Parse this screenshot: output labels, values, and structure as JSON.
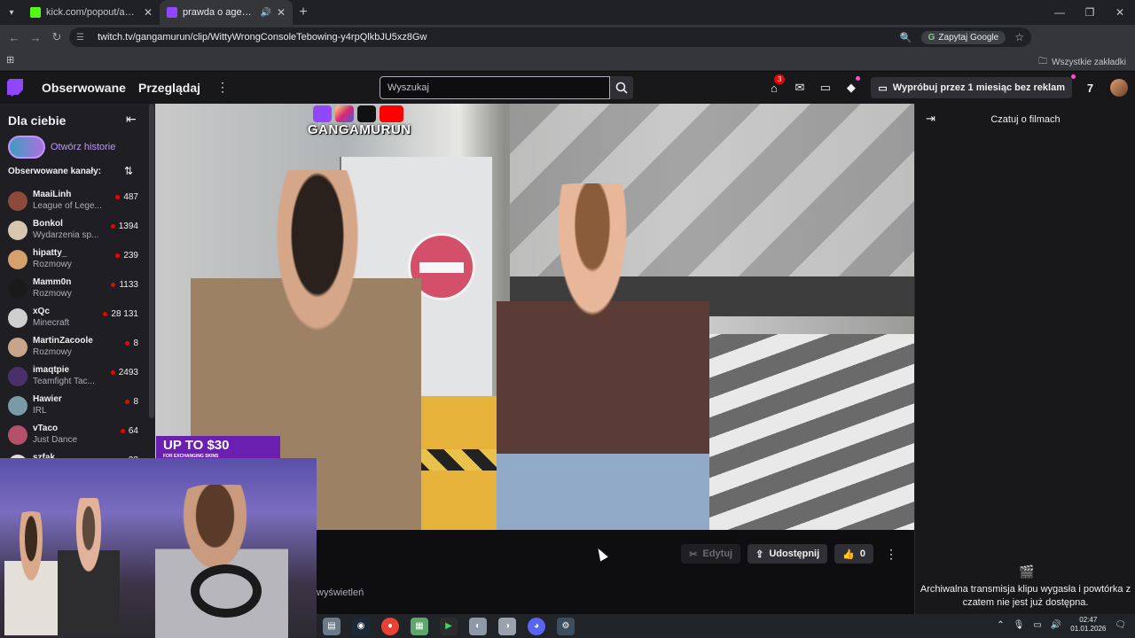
{
  "browser": {
    "tabs": [
      {
        "title": "kick.com/popout/ahapulco/cha",
        "favicon_color": "#53fc18",
        "active": false
      },
      {
        "title": "prawda o agencie - Twitch",
        "favicon_color": "#9147ff",
        "active": true
      }
    ],
    "url": "twitch.tv/gangamurun/clip/WittyWrongConsoleTebowing-y4rpQlkbJU5xz8Gw",
    "ask_google": "Zapytaj Google",
    "bookmarks_all": "Wszystkie zakładki"
  },
  "twitch": {
    "nav": {
      "following": "Obserwowane",
      "browse": "Przeglądaj",
      "search_placeholder": "Wyszukaj",
      "notifications_count": "3",
      "prime_cta": "Wypróbuj przez 1 miesiąc bez reklam"
    },
    "sidebar": {
      "for_you": "Dla ciebie",
      "stories": "Otwórz historie",
      "followed_channels": "Obserwowane kanały:",
      "channels": [
        {
          "name": "MaaiLinh",
          "category": "League of Lege...",
          "viewers": "487",
          "avatar_color": "#8b4a3a"
        },
        {
          "name": "Bonkol",
          "category": "Wydarzenia sp...",
          "viewers": "1394",
          "avatar_color": "#d8c7b0"
        },
        {
          "name": "hipatty_",
          "category": "Rozmowy",
          "viewers": "239",
          "avatar_color": "#d6a06a"
        },
        {
          "name": "Mamm0n",
          "category": "Rozmowy",
          "viewers": "1133",
          "avatar_color": "#1a1a1a"
        },
        {
          "name": "xQc",
          "category": "Minecraft",
          "viewers": "28 131",
          "avatar_color": "#cfcfcf"
        },
        {
          "name": "MartinZacoole",
          "category": "Rozmowy",
          "viewers": "8",
          "avatar_color": "#c7a58a"
        },
        {
          "name": "imaqtpie",
          "category": "Teamfight Tac...",
          "viewers": "2493",
          "avatar_color": "#4a2f6a"
        },
        {
          "name": "Hawier",
          "category": "IRL",
          "viewers": "8",
          "avatar_color": "#7a9aa8"
        },
        {
          "name": "vTaco",
          "category": "Just Dance",
          "viewers": "64",
          "avatar_color": "#b5506a"
        },
        {
          "name": "szfak",
          "category": "",
          "viewers": "22",
          "avatar_color": "#e0e0e0"
        }
      ]
    },
    "video": {
      "channel_watermark": "GANGAMURUN",
      "promo_big": "UP TO $30",
      "promo_small": "FOR EXCHANGING SKINS"
    },
    "clip_actions": {
      "edit": "Edytuj",
      "share": "Udostępnij",
      "likes": "0"
    },
    "views_text": "wyświetleń",
    "chat": {
      "title": "Czatuj o filmach",
      "message": "Archiwalna transmisja klipu wygasła i powtórka z czatem nie jest już dostępna."
    }
  },
  "taskbar": {
    "time": "02:47",
    "date": "01.01.2026"
  },
  "colors": {
    "twitch_purple": "#9147ff",
    "live_red": "#eb0400",
    "background": "#0e0e10"
  }
}
